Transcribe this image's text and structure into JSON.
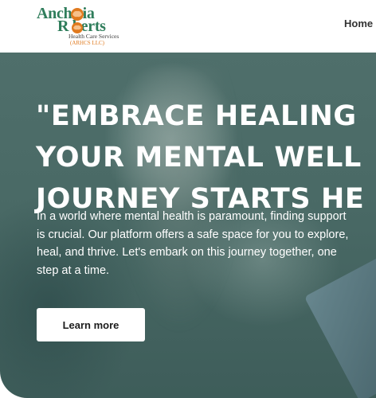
{
  "brand": {
    "name_line1": "Anch ria",
    "name_line2": "R berts",
    "subtitle": "Health Care Services",
    "tagline": "(ARHCS LLC)",
    "colors": {
      "green": "#2f7d5b",
      "orange": "#e07a1f"
    }
  },
  "nav": {
    "home": "Home"
  },
  "hero": {
    "title_lines": [
      "\"EMBRACE HEALING",
      "YOUR MENTAL WELL",
      "JOURNEY STARTS HE"
    ],
    "text": "In a world where mental health is paramount, finding support is crucial. Our platform offers a safe space for you to explore, heal, and thrive. Let's embark on this journey together, one step at a time.",
    "cta_label": "Learn more"
  }
}
